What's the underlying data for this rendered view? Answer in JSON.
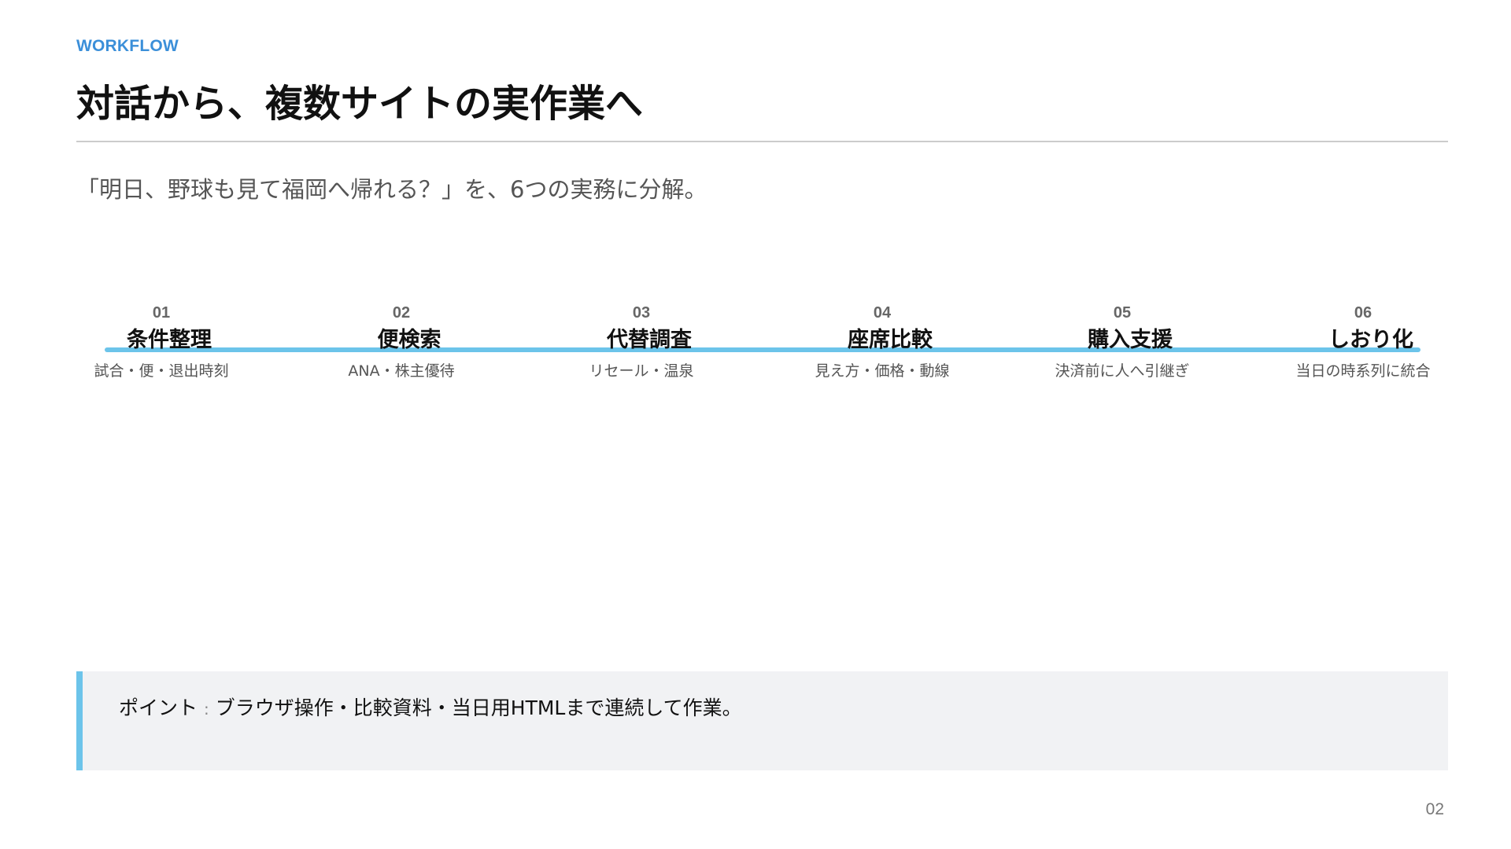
{
  "slide": {
    "eyebrow": "WORKFLOW",
    "title": "対話から、複数サイトの実作業へ",
    "subtitle": "「明日、野球も見て福岡へ帰れる？」を、6つの実務に分解。",
    "page_number": "02"
  },
  "steps": [
    {
      "num": "01",
      "title": "条件整理",
      "desc": "試合・便・退出時刻"
    },
    {
      "num": "02",
      "title": "便検索",
      "desc": "ANA・株主優待"
    },
    {
      "num": "03",
      "title": "代替調査",
      "desc": "リセール・温泉"
    },
    {
      "num": "04",
      "title": "座席比較",
      "desc": "見え方・価格・動線"
    },
    {
      "num": "05",
      "title": "購入支援",
      "desc": "決済前に人へ引継ぎ"
    },
    {
      "num": "06",
      "title": "しおり化",
      "desc": "当日の時系列に統合"
    }
  ],
  "note": {
    "label": "ポイント",
    "separator": ":",
    "text": "ブラウザ操作・比較資料・当日用HTMLまで連続して作業。"
  },
  "colors": {
    "accent": "#3b8fd9",
    "timeline": "#6cc4ea",
    "note_background": "#f1f2f4"
  }
}
